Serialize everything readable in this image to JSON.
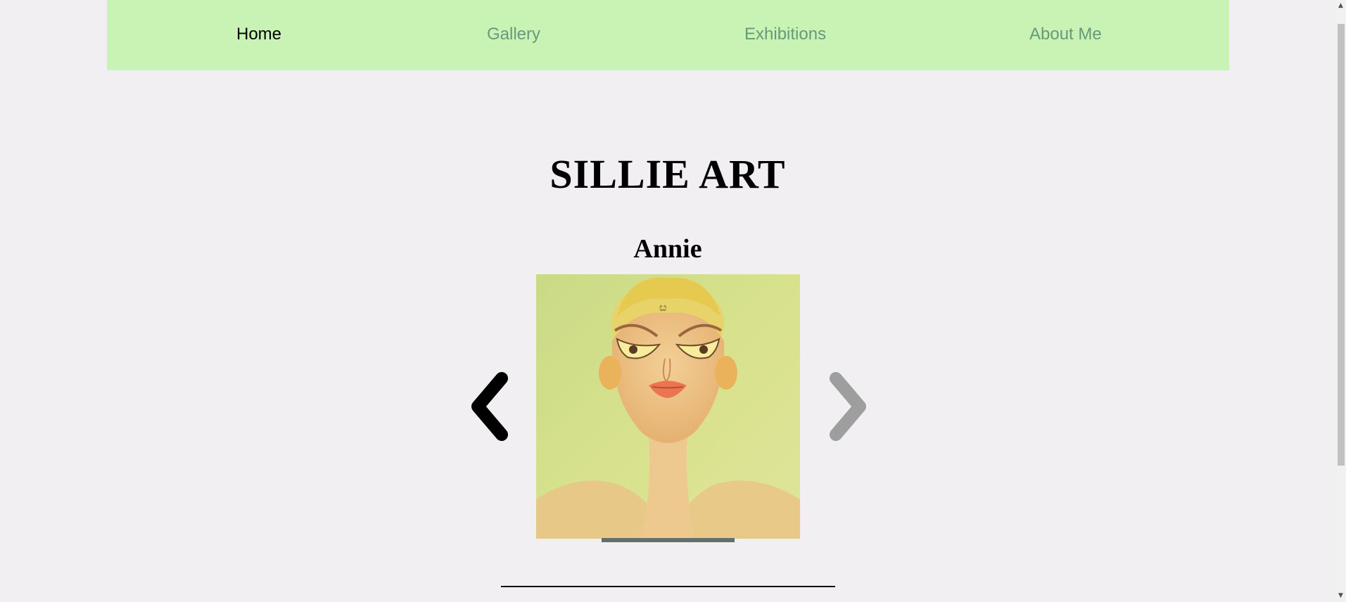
{
  "nav": {
    "items": [
      {
        "label": "Home",
        "active": true
      },
      {
        "label": "Gallery",
        "active": false
      },
      {
        "label": "Exhibitions",
        "active": false
      },
      {
        "label": "About Me",
        "active": false
      }
    ]
  },
  "main": {
    "site_title": "SILLIE ART",
    "slideshow": {
      "current_title": "Annie",
      "prev_icon": "chevron-left-icon",
      "next_icon": "chevron-right-icon"
    }
  },
  "colors": {
    "nav_background": "#c8f3b5",
    "nav_link": "#679a7a",
    "nav_link_active": "#000000",
    "page_background": "#f1eff2",
    "next_arrow": "#9e9e9e",
    "prev_arrow": "#000000",
    "slide_indicator": "#656f6a"
  },
  "scrollbar": {
    "up_icon": "arrow-up-icon",
    "down_icon": "arrow-down-icon"
  }
}
